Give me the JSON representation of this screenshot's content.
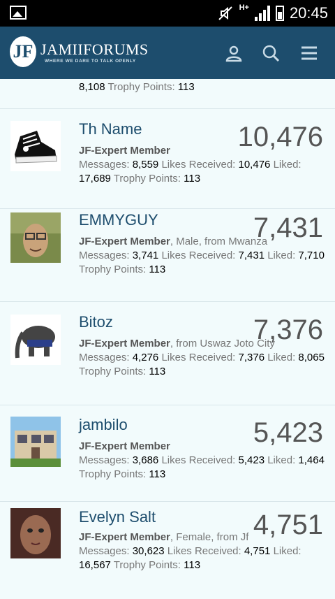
{
  "status_bar": {
    "network": "H+",
    "time": "20:45"
  },
  "header": {
    "logo_letter": "JF",
    "logo_text": "JAMIIFORUMS",
    "tagline": "WHERE WE DARE TO TALK OPENLY"
  },
  "labels": {
    "messages": "Messages:",
    "likes_received": "Likes Received:",
    "liked": "Liked:",
    "trophy_points": "Trophy Points:"
  },
  "partial_row": {
    "liked": "8,108",
    "trophy": "113"
  },
  "members": [
    {
      "name": "Th Name",
      "rank": "JF-Expert Member",
      "extra": "",
      "messages": "8,559",
      "likes_received": "10,476",
      "liked": "17,689",
      "trophy": "113",
      "count": "10,476"
    },
    {
      "name": "EMMYGUY",
      "rank": "JF-Expert Member",
      "extra": ", Male, from Mwanza",
      "messages": "3,741",
      "likes_received": "7,431",
      "liked": "7,710",
      "trophy": "113",
      "count": "7,431"
    },
    {
      "name": "Bitoz",
      "rank": "JF-Expert Member",
      "extra": ", from Uswaz Joto City",
      "messages": "4,276",
      "likes_received": "7,376",
      "liked": "8,065",
      "trophy": "113",
      "count": "7,376"
    },
    {
      "name": "jambilo",
      "rank": "JF-Expert Member",
      "extra": "",
      "messages": "3,686",
      "likes_received": "5,423",
      "liked": "1,464",
      "trophy": "113",
      "count": "5,423"
    },
    {
      "name": "Evelyn Salt",
      "rank": "JF-Expert Member",
      "extra": ", Female, from Jf",
      "messages": "30,623",
      "likes_received": "4,751",
      "liked": "16,567",
      "trophy": "113",
      "count": "4,751"
    }
  ],
  "colors": {
    "header_bg": "#1d4d6d",
    "page_bg": "#f2fbfc",
    "name_color": "#1d4d6d"
  }
}
